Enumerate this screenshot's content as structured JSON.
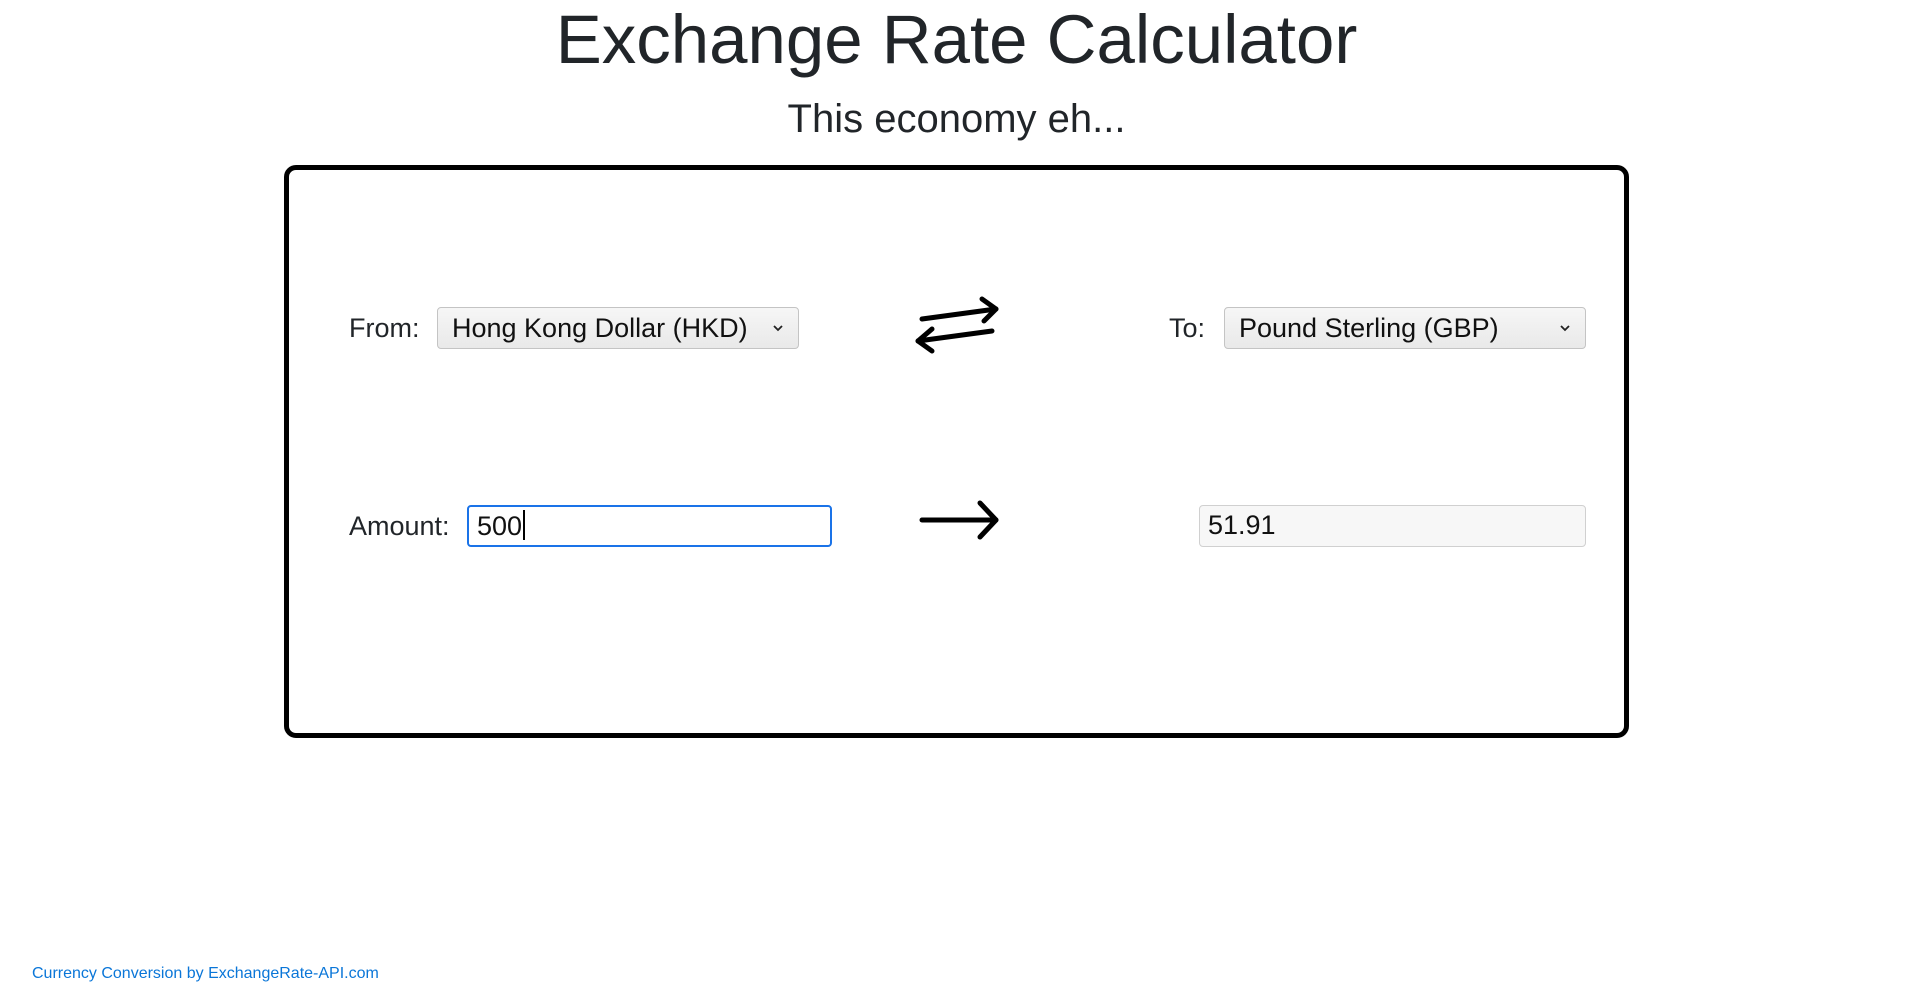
{
  "header": {
    "title": "Exchange Rate Calculator",
    "subtitle": "This economy eh..."
  },
  "converter": {
    "from_label": "From:",
    "from_currency": "Hong Kong Dollar (HKD)",
    "to_label": "To:",
    "to_currency": "Pound Sterling (GBP)",
    "amount_label": "Amount:",
    "amount_value": "500",
    "result_value": "51.91",
    "swap_icon": "swap-arrows-icon",
    "result_arrow_icon": "arrow-right-icon"
  },
  "footer": {
    "attribution": "Currency Conversion by ExchangeRate-API.com"
  },
  "colors": {
    "text": "#212529",
    "card_border": "#000000",
    "focus_border": "#1a73e8",
    "link": "#0a76d8"
  }
}
